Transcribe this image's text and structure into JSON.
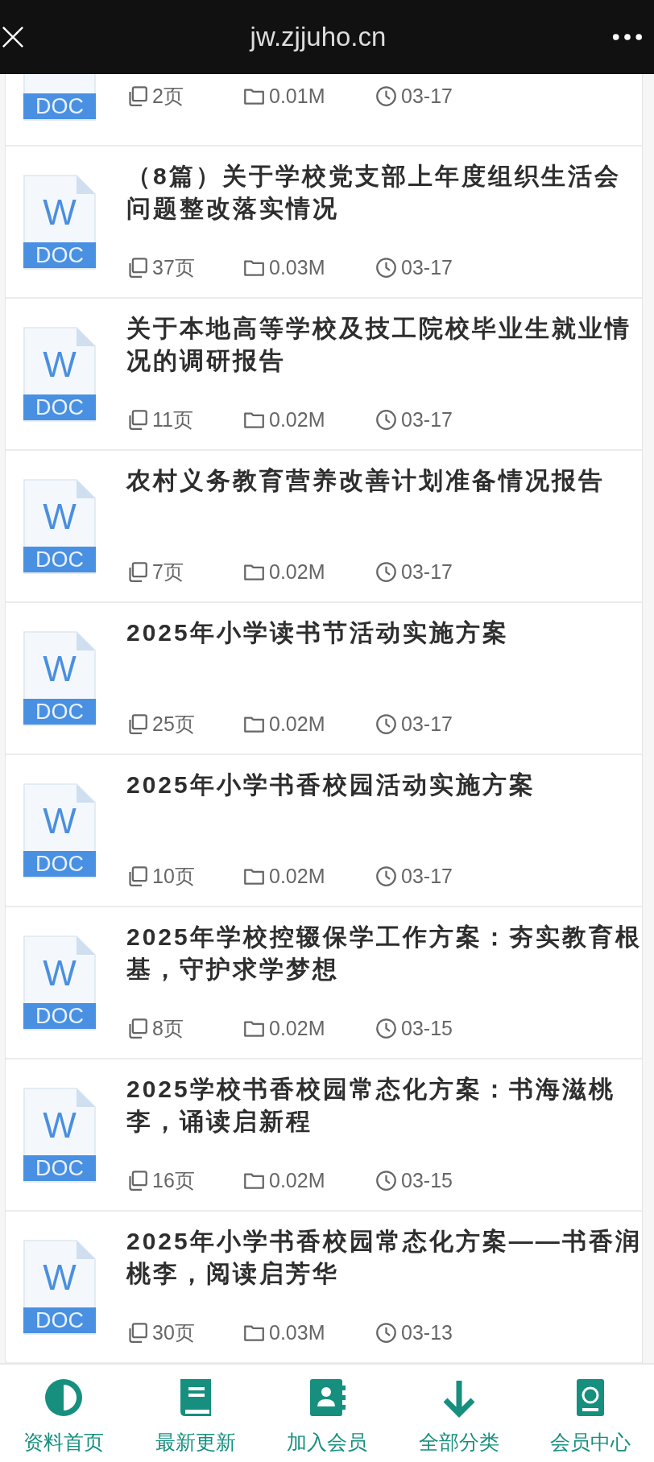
{
  "header": {
    "title": "jw.zjjuho.cn"
  },
  "documents": [
    {
      "file_type": "DOC",
      "pages": "2页",
      "size": "0.01M",
      "date": "03-17"
    },
    {
      "file_letter": "W",
      "file_type": "DOC",
      "title": "（8篇）关于学校党支部上年度组织生活会问题整改落实情况",
      "pages": "37页",
      "size": "0.03M",
      "date": "03-17"
    },
    {
      "file_letter": "W",
      "file_type": "DOC",
      "title": "关于本地高等学校及技工院校毕业生就业情况的调研报告",
      "pages": "11页",
      "size": "0.02M",
      "date": "03-17"
    },
    {
      "file_letter": "W",
      "file_type": "DOC",
      "title": "农村义务教育营养改善计划准备情况报告",
      "pages": "7页",
      "size": "0.02M",
      "date": "03-17"
    },
    {
      "file_letter": "W",
      "file_type": "DOC",
      "title": "2025年小学读书节活动实施方案",
      "pages": "25页",
      "size": "0.02M",
      "date": "03-17"
    },
    {
      "file_letter": "W",
      "file_type": "DOC",
      "title": "2025年小学书香校园活动实施方案",
      "pages": "10页",
      "size": "0.02M",
      "date": "03-17"
    },
    {
      "file_letter": "W",
      "file_type": "DOC",
      "title": "2025年学校控辍保学工作方案：夯实教育根基，守护求学梦想",
      "pages": "8页",
      "size": "0.02M",
      "date": "03-15"
    },
    {
      "file_letter": "W",
      "file_type": "DOC",
      "title": "2025学校书香校园常态化方案：书海滋桃李，诵读启新程",
      "pages": "16页",
      "size": "0.02M",
      "date": "03-15"
    },
    {
      "file_letter": "W",
      "file_type": "DOC",
      "title": "2025年小学书香校园常态化方案——书香润桃李，阅读启芳华",
      "pages": "30页",
      "size": "0.03M",
      "date": "03-13"
    }
  ],
  "bottom_nav": [
    {
      "label": "资料首页"
    },
    {
      "label": "最新更新"
    },
    {
      "label": "加入会员"
    },
    {
      "label": "全部分类"
    },
    {
      "label": "会员中心"
    }
  ]
}
